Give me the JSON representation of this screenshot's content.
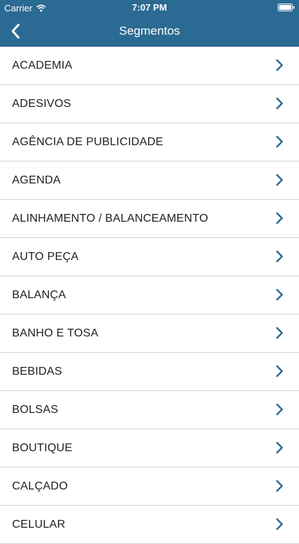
{
  "status_bar": {
    "carrier": "Carrier",
    "time": "7:07 PM",
    "wifi_icon": "wifi-icon",
    "battery_icon": "battery-icon"
  },
  "nav": {
    "title": "Segmentos",
    "back_icon": "chevron-left-icon"
  },
  "segments": [
    {
      "label": "ACADEMIA"
    },
    {
      "label": "ADESIVOS"
    },
    {
      "label": "AGÊNCIA DE PUBLICIDADE"
    },
    {
      "label": "AGENDA"
    },
    {
      "label": "ALINHAMENTO / BALANCEAMENTO"
    },
    {
      "label": "AUTO PEÇA"
    },
    {
      "label": "BALANÇA"
    },
    {
      "label": "BANHO E TOSA"
    },
    {
      "label": "BEBIDAS"
    },
    {
      "label": "BOLSAS"
    },
    {
      "label": "BOUTIQUE"
    },
    {
      "label": "CALÇADO"
    },
    {
      "label": "CELULAR"
    }
  ],
  "colors": {
    "header": "#2b6a92",
    "chevron": "#2b6a92",
    "separator": "#d2d2d6"
  }
}
